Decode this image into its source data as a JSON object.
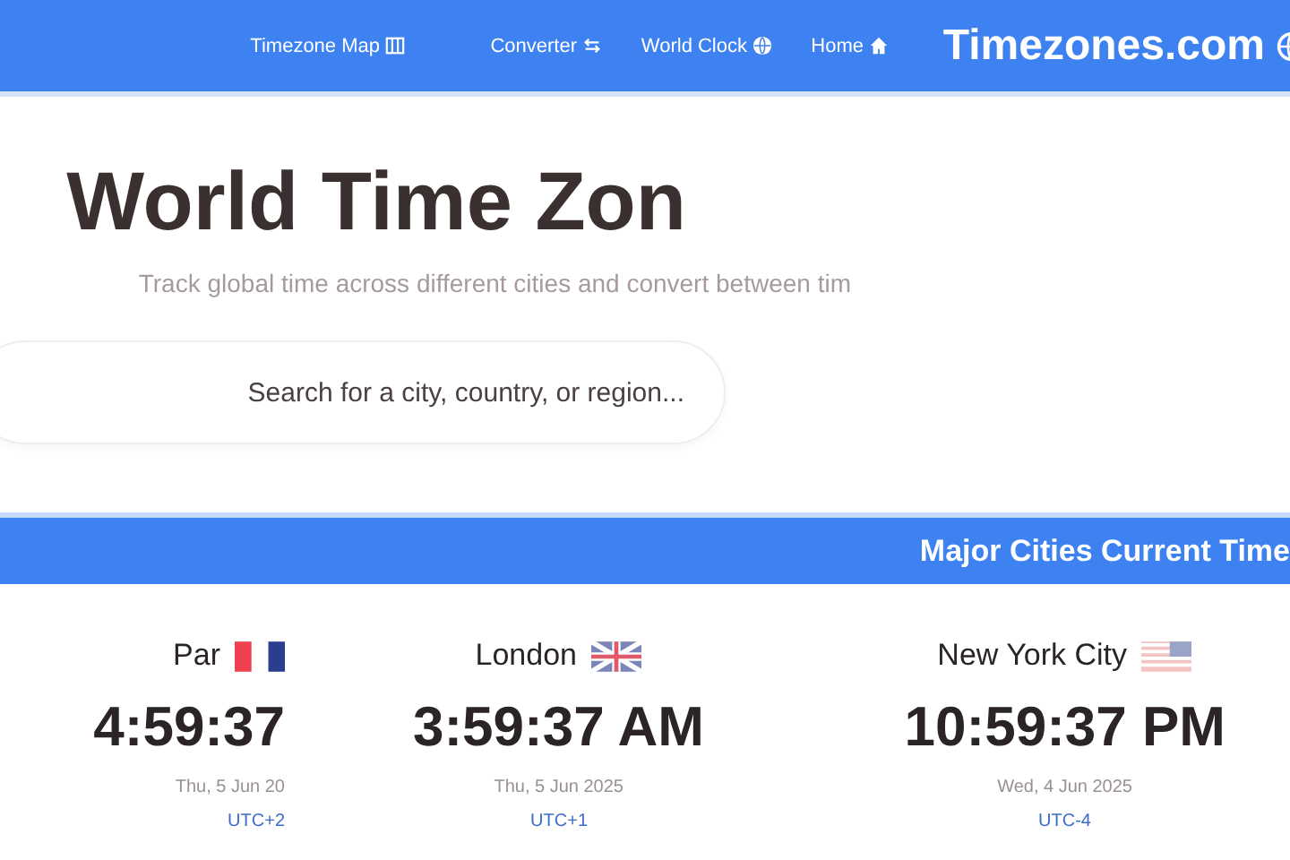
{
  "nav": {
    "logo": "Timezones.com",
    "links": [
      {
        "label": "Timezone Map",
        "kind": "map"
      },
      {
        "label": "Converter",
        "kind": "swap"
      },
      {
        "label": "World Clock",
        "kind": "globe"
      },
      {
        "label": "Home",
        "kind": "home"
      }
    ]
  },
  "hero": {
    "title": "World Time Zon",
    "subtitle": "Track global time across different cities and convert between tim",
    "search": {
      "placeholder": "Search for a city, country, or region..."
    }
  },
  "section": {
    "title": "Major Cities Current Time",
    "cities": [
      {
        "name": "Par",
        "kind": "fr",
        "time": "4:59:37",
        "date": "Thu, 5 Jun 20",
        "utc": "UTC+2"
      },
      {
        "name": "London",
        "kind": "uk",
        "time": "3:59:37 AM",
        "date": "Thu, 5 Jun 2025",
        "utc": "UTC+1"
      },
      {
        "name": "New York City",
        "kind": "us",
        "time": "10:59:37 PM",
        "date": "Wed, 4 Jun 2025",
        "utc": "UTC-4"
      }
    ]
  }
}
